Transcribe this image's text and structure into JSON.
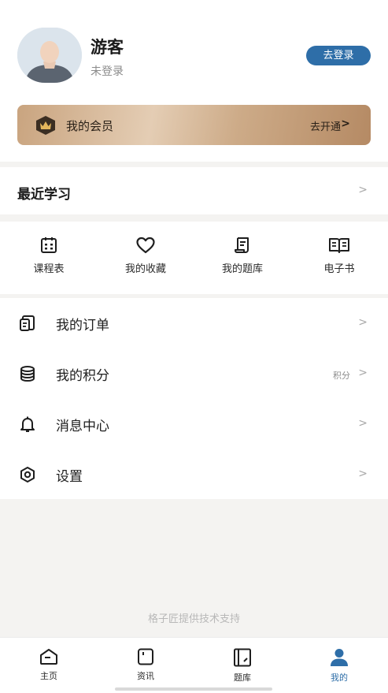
{
  "profile": {
    "name": "游客",
    "status": "未登录",
    "login_button": "去登录"
  },
  "vip": {
    "label": "我的会员",
    "action": "去开通",
    "chevron": ">"
  },
  "recent": {
    "title": "最近学习",
    "chevron": ">"
  },
  "shortcuts": [
    {
      "label": "课程表",
      "icon": "calendar-icon"
    },
    {
      "label": "我的收藏",
      "icon": "heart-icon"
    },
    {
      "label": "我的题库",
      "icon": "scroll-icon"
    },
    {
      "label": "电子书",
      "icon": "book-icon"
    }
  ],
  "menu": [
    {
      "label": "我的订单",
      "icon": "order-icon",
      "extra": "",
      "chevron": ">"
    },
    {
      "label": "我的积分",
      "icon": "coins-icon",
      "extra": "积分",
      "chevron": ">"
    },
    {
      "label": "消息中心",
      "icon": "bell-icon",
      "extra": "",
      "chevron": ">"
    },
    {
      "label": "设置",
      "icon": "settings-icon",
      "extra": "",
      "chevron": ">"
    }
  ],
  "footer": {
    "credit": "格子匠提供技术支持"
  },
  "tabbar": [
    {
      "label": "主页",
      "icon": "home-icon",
      "active": false
    },
    {
      "label": "资讯",
      "icon": "news-icon",
      "active": false
    },
    {
      "label": "题库",
      "icon": "question-bank-icon",
      "active": false
    },
    {
      "label": "我的",
      "icon": "profile-icon",
      "active": true
    }
  ],
  "colors": {
    "accent": "#2e6ea8",
    "vip_gold": "#c9a47f",
    "background": "#f4f3f1"
  }
}
